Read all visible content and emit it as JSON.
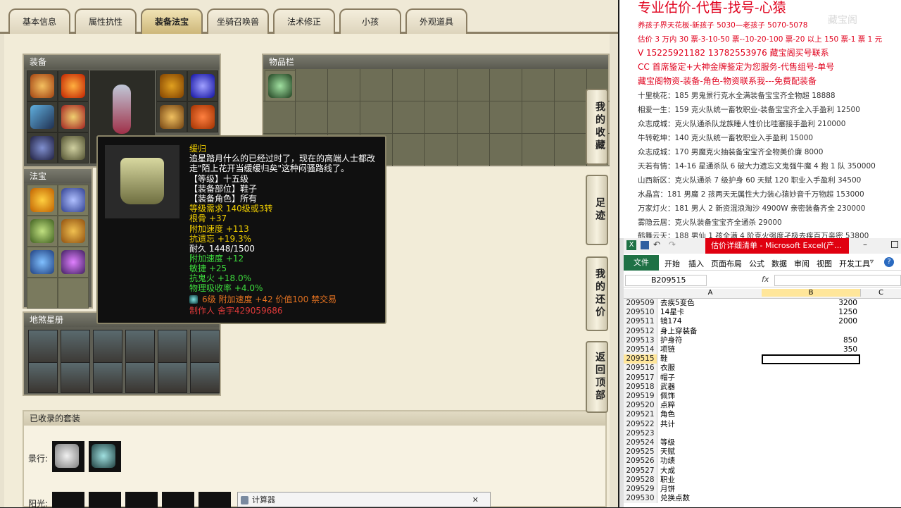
{
  "tabs": [
    "基本信息",
    "属性抗性",
    "装备法宝",
    "坐骑召唤兽",
    "法术修正",
    "小孩",
    "外观道具"
  ],
  "active_tab": "装备法宝",
  "panels": {
    "equip": "装备",
    "items": "物品栏",
    "fabao": "法宝",
    "xingshu": "地煞星册",
    "suits": "已收录的套装",
    "suit_label": "景行:",
    "suit_label2": "阳光:"
  },
  "side_buttons": [
    "我的收藏",
    "足迹",
    "我的还价",
    "返回顶部"
  ],
  "tooltip": {
    "name": "缓归",
    "desc1": "追星踏月什么的已经过时了，现在的高端人士都改",
    "desc2": "走\"陌上花开当缓缓归矣\"这种闷骚路线了。",
    "level": "【等级】十五级",
    "slot": "【装备部位】鞋子",
    "role": "【装备角色】所有",
    "req": "等级需求 140级或3转",
    "stat1": "根骨 +37",
    "stat2": "附加速度 +113",
    "stat3": "抗遗忘 +19.3%",
    "durability": "耐久 1448/1500",
    "stat4": "附加速度 +12",
    "stat5": "敏捷 +25",
    "stat6": "抗鬼火 +18.0%",
    "stat7": "物理吸收率 +4.0%",
    "gem": "6级 附加速度 +42 价值100 禁交易",
    "maker": "制作人 舍宇429059686",
    "colors": {
      "title": "#f2d000",
      "white": "#ffffff",
      "green": "#3edc3e",
      "red": "#e03a3a",
      "orange": "#e07020"
    }
  },
  "overlay": {
    "title": "专业估价-代售-找号-心猿",
    "watermark": "藏宝阁",
    "lines": [
      "养孩子界天花板-新孩子 5030—老孩子 5070-5078",
      "估价 3 万内 30 票-3-10-50 票--10-20-100 票-20 以上 150 票-1 票 1 元",
      "V 15225921182       13782553976     藏宝阁买号联系",
      "CC 首席鉴定+大神金牌鉴定为您服务-代售组号-单号",
      "藏宝阁物资-装备-角色-物资联系我---免费配装备",
      "十里桃花：185 男鬼景行克水全满装备宝宝齐全物超 18888",
      "相爱一生：159 克火队统一畜牧职业-装备宝宝齐全入手盈利 12500",
      "众志成城：克火队通杀队龙族睡人性价比哇塞接手盈利 210000",
      "牛转乾坤：140 克火队统一畜牧职业入手盈利 15000",
      "众志成城：170 男魔克火抽装备宝宝齐全物美价廉 8000",
      "天若有情：14-16 星通杀队 6 破大力遗忘文鬼强牛魔 4 抱 1 队 350000",
      "山西新区：克火队通杀 7 级护身 60 天赋 120 职业入手盈利 34500",
      "水晶宫：181 男魔 2 孩两天无属性大力装心猿妙音千万物超 153000",
      "万家灯火：181 男人 2 新资混浪淘沙 4900W 亲密装备齐全 230000",
      "雾隐云居：克火队装备宝宝齐全通杀 29000",
      "鹤舞云天：188 男仙 1 孩全满 4 阶克火强度孑极去疾百万亲密 53800"
    ]
  },
  "excel": {
    "title": "估价详细清单 - Microsoft Excel(产…",
    "ribbon": [
      "文件",
      "开始",
      "插入",
      "页面布局",
      "公式",
      "数据",
      "审阅",
      "视图",
      "开发工具"
    ],
    "cell_ref": "B209515",
    "fx": "fx",
    "cols": [
      "A",
      "B",
      "C"
    ],
    "rows": [
      {
        "n": "209509",
        "a": "去疾5变色",
        "b": "3200"
      },
      {
        "n": "209510",
        "a": "14星卡",
        "b": "1250"
      },
      {
        "n": "209511",
        "a": "镜174",
        "b": "2000"
      },
      {
        "n": "209512",
        "a": "身上穿装备",
        "b": ""
      },
      {
        "n": "209513",
        "a": "护身符",
        "b": "850"
      },
      {
        "n": "209514",
        "a": "项链",
        "b": "350"
      },
      {
        "n": "209515",
        "a": "鞋",
        "b": ""
      },
      {
        "n": "209516",
        "a": "衣服",
        "b": ""
      },
      {
        "n": "209517",
        "a": "帽子",
        "b": ""
      },
      {
        "n": "209518",
        "a": "武器",
        "b": ""
      },
      {
        "n": "209519",
        "a": "佩饰",
        "b": ""
      },
      {
        "n": "209520",
        "a": "点粹",
        "b": ""
      },
      {
        "n": "209521",
        "a": "角色",
        "b": ""
      },
      {
        "n": "209522",
        "a": "共计",
        "b": ""
      },
      {
        "n": "209523",
        "a": "",
        "b": ""
      },
      {
        "n": "209524",
        "a": "等级",
        "b": ""
      },
      {
        "n": "209525",
        "a": "天赋",
        "b": ""
      },
      {
        "n": "209526",
        "a": "功绩",
        "b": ""
      },
      {
        "n": "209527",
        "a": "大成",
        "b": ""
      },
      {
        "n": "209528",
        "a": "职业",
        "b": ""
      },
      {
        "n": "209529",
        "a": "月饼",
        "b": ""
      },
      {
        "n": "209530",
        "a": "兑换点数",
        "b": ""
      }
    ]
  },
  "calc": "计算器"
}
